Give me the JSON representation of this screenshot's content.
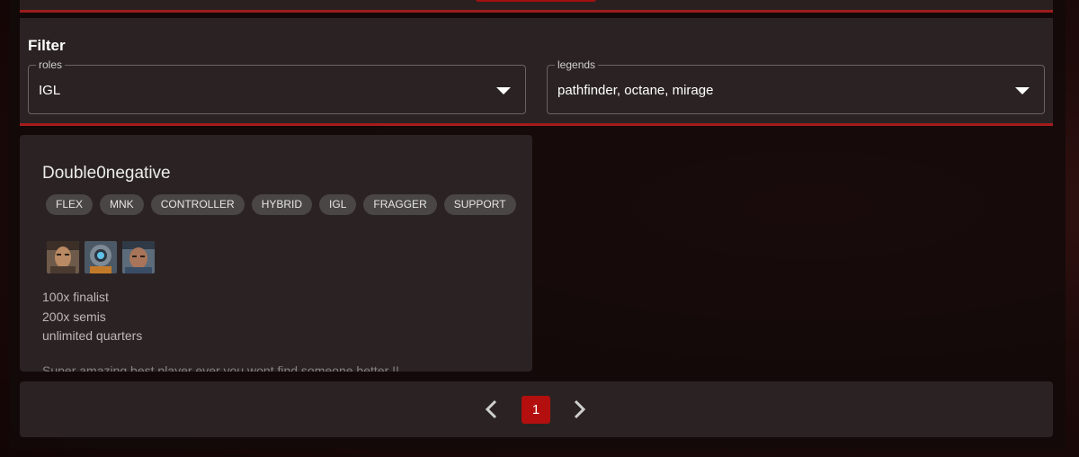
{
  "filter": {
    "title": "Filter",
    "roles": {
      "label": "roles",
      "value": "IGL"
    },
    "legends": {
      "label": "legends",
      "value": "pathfinder, octane, mirage"
    }
  },
  "player": {
    "name": "Double0negative",
    "roles": [
      "FLEX",
      "MNK",
      "CONTROLLER",
      "HYBRID",
      "IGL",
      "FRAGGER",
      "SUPPORT"
    ],
    "legend_icons": [
      "legend-portrait-1-icon",
      "legend-portrait-2-icon",
      "legend-portrait-3-icon"
    ],
    "achievements": [
      "100x finalist",
      "200x semis",
      "unlimited quarters"
    ],
    "description": "Super amazing best player ever you wont find someone better !!"
  },
  "pagination": {
    "current_page": "1"
  },
  "colors": {
    "accent": "#b30f0f",
    "panel": "#2b2323",
    "chip": "#4a4646"
  }
}
